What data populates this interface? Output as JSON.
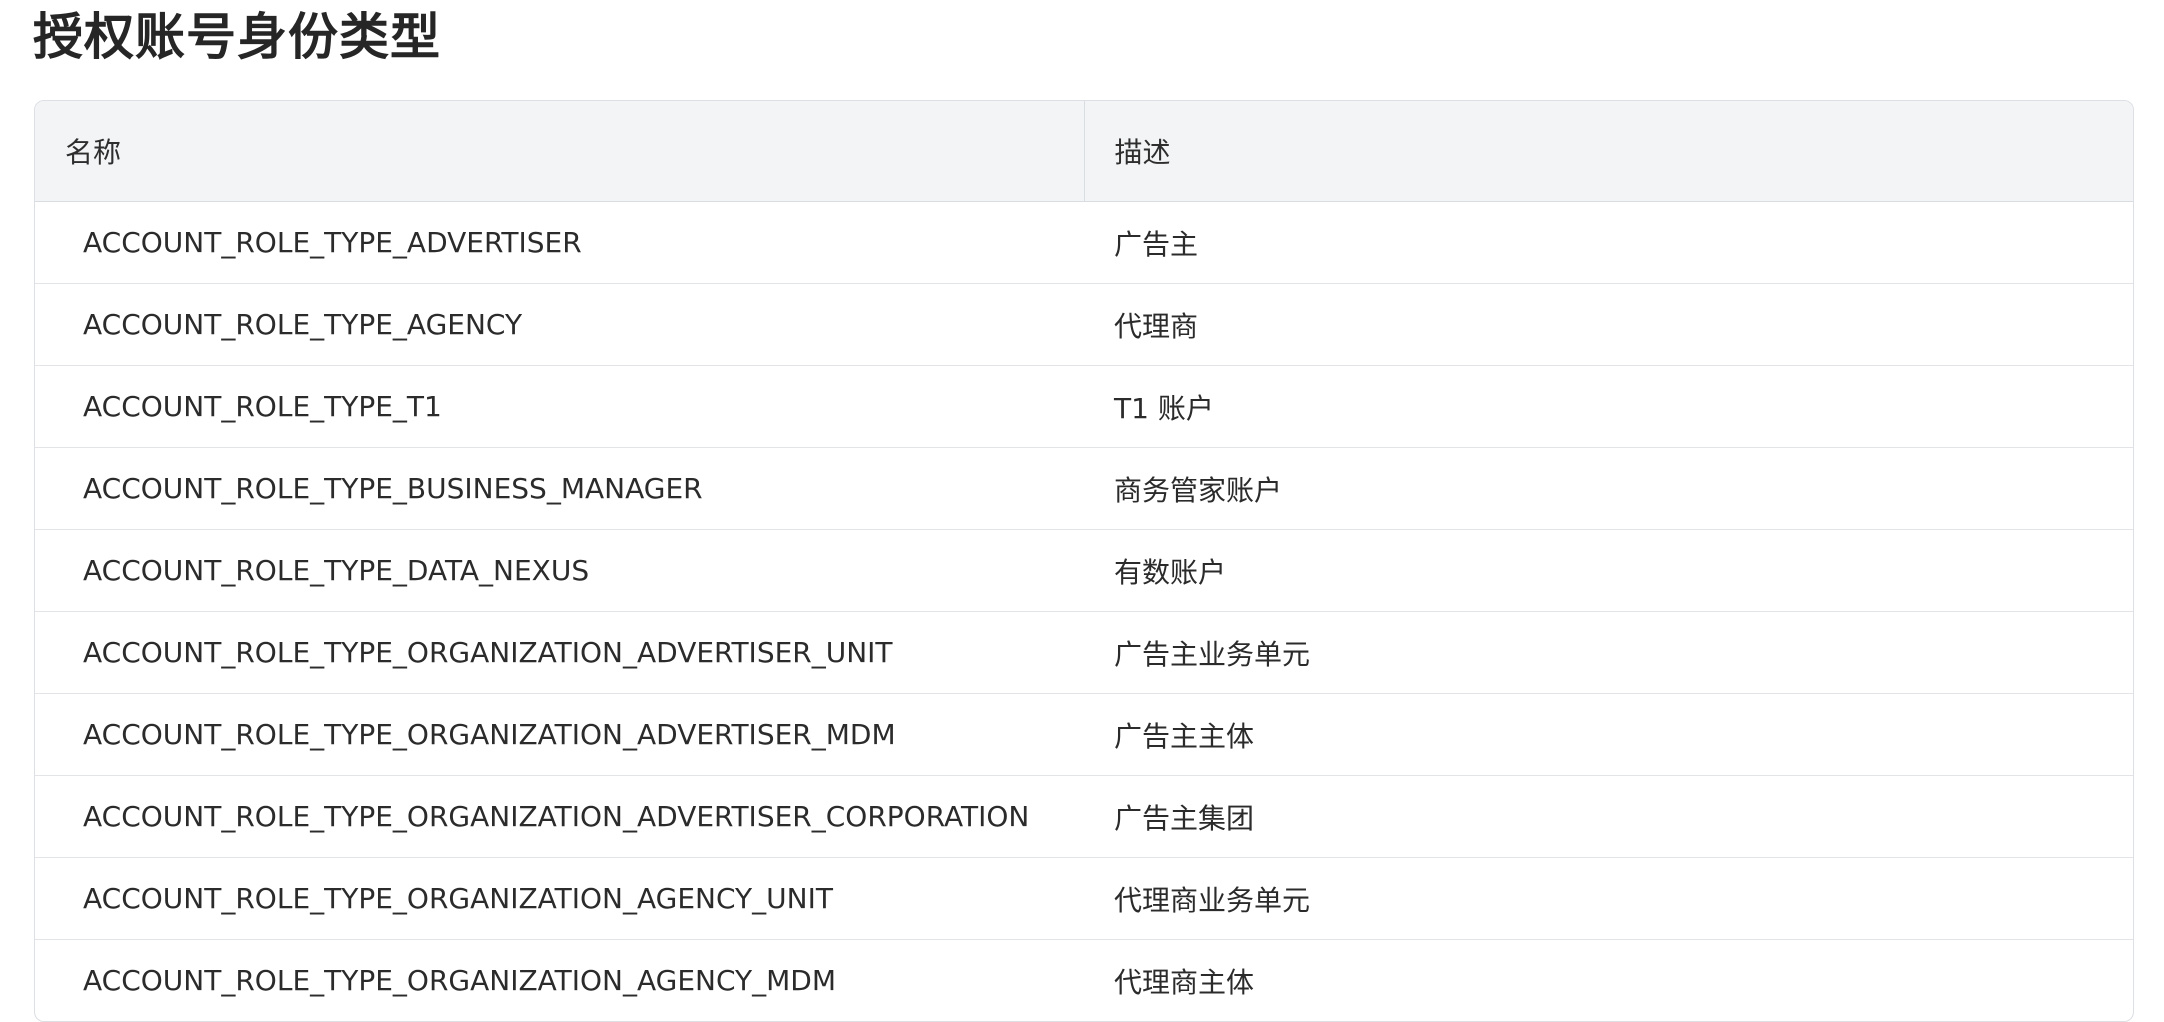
{
  "title": "授权账号身份类型",
  "table": {
    "headers": {
      "name": "名称",
      "description": "描述"
    },
    "rows": [
      {
        "name": "ACCOUNT_ROLE_TYPE_ADVERTISER",
        "description": "广告主"
      },
      {
        "name": "ACCOUNT_ROLE_TYPE_AGENCY",
        "description": "代理商"
      },
      {
        "name": "ACCOUNT_ROLE_TYPE_T1",
        "description": "T1 账户"
      },
      {
        "name": "ACCOUNT_ROLE_TYPE_BUSINESS_MANAGER",
        "description": "商务管家账户"
      },
      {
        "name": "ACCOUNT_ROLE_TYPE_DATA_NEXUS",
        "description": "有数账户"
      },
      {
        "name": "ACCOUNT_ROLE_TYPE_ORGANIZATION_ADVERTISER_UNIT",
        "description": "广告主业务单元"
      },
      {
        "name": "ACCOUNT_ROLE_TYPE_ORGANIZATION_ADVERTISER_MDM",
        "description": "广告主主体"
      },
      {
        "name": "ACCOUNT_ROLE_TYPE_ORGANIZATION_ADVERTISER_CORPORATION",
        "description": "广告主集团"
      },
      {
        "name": "ACCOUNT_ROLE_TYPE_ORGANIZATION_AGENCY_UNIT",
        "description": "代理商业务单元"
      },
      {
        "name": "ACCOUNT_ROLE_TYPE_ORGANIZATION_AGENCY_MDM",
        "description": "代理商主体"
      }
    ]
  }
}
